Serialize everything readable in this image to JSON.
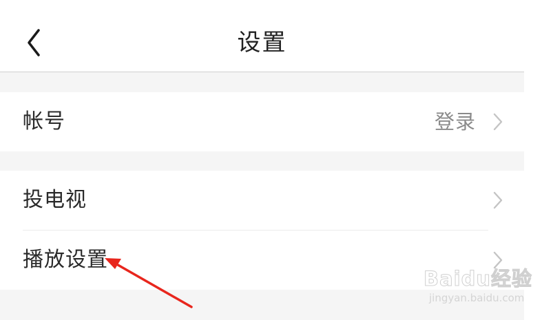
{
  "header": {
    "title": "设置",
    "back_icon": "chevron-left-icon"
  },
  "settings": {
    "account": {
      "label": "帐号",
      "value": "登录",
      "icon": "chevron-right-icon"
    },
    "cast_tv": {
      "label": "投电视",
      "icon": "chevron-right-icon"
    },
    "playback": {
      "label": "播放设置",
      "icon": "chevron-right-icon"
    }
  },
  "annotation": {
    "arrow_color": "#e8261d",
    "icon": "red-arrow-icon"
  },
  "watermark": {
    "logo": "Baidu经验",
    "url": "jingyan.baidu.com"
  },
  "colors": {
    "background": "#ffffff",
    "section_gap": "#f5f5f5",
    "label_text": "#2a2a2a",
    "secondary_text": "#8a8a8a",
    "chevron": "#c4c4c4"
  }
}
